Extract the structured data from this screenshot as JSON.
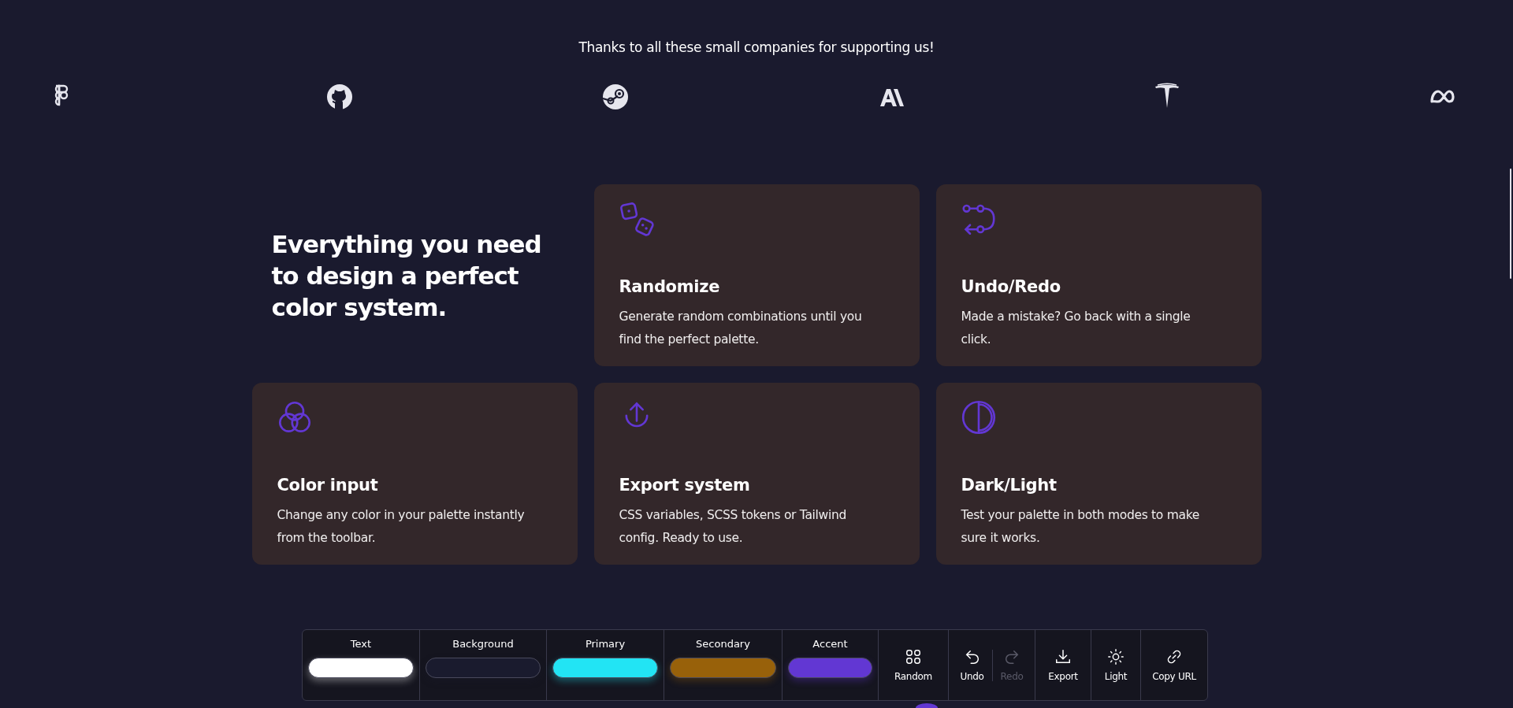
{
  "sponsors": {
    "caption": "Thanks to all these small companies for supporting us!",
    "logos": [
      {
        "kind": "figma"
      },
      {
        "kind": "github"
      },
      {
        "kind": "steam"
      },
      {
        "kind": "anthropic"
      },
      {
        "kind": "tesla"
      },
      {
        "kind": "meta"
      }
    ]
  },
  "features": {
    "heading": "Everything you need to design a perfect color system.",
    "cards": [
      {
        "kind": "dice",
        "title": "Randomize",
        "text": "Generate random combinations until you find the perfect palette."
      },
      {
        "kind": "undo-redo",
        "title": "Undo/Redo",
        "text": "Made a mistake? Go back with a single click."
      },
      {
        "kind": "circles",
        "title": "Color input",
        "text": "Change any color in your palette instantly from the toolbar."
      },
      {
        "kind": "upload",
        "title": "Export system",
        "text": "CSS variables, SCSS tokens or Tailwind config. Ready to use."
      },
      {
        "kind": "half-circle",
        "title": "Dark/Light",
        "text": "Test your palette in both modes to make sure it works."
      }
    ]
  },
  "toolbar": {
    "swatches": [
      {
        "label": "Text",
        "color": "#ffffff"
      },
      {
        "label": "Background",
        "color": "#1a1b2e"
      },
      {
        "label": "Primary",
        "color": "#22e4f4"
      },
      {
        "label": "Secondary",
        "color": "#98610a"
      },
      {
        "label": "Accent",
        "color": "#6237d3"
      }
    ],
    "actions": [
      {
        "kind": "random",
        "label": "Random",
        "disabled": false
      },
      {
        "kind": "undo",
        "label": "Undo",
        "disabled": false
      },
      {
        "kind": "redo",
        "label": "Redo",
        "disabled": true
      },
      {
        "kind": "export",
        "label": "Export",
        "disabled": false
      },
      {
        "kind": "light",
        "label": "Light",
        "disabled": false
      },
      {
        "kind": "link",
        "label": "Copy URL",
        "disabled": false
      }
    ]
  }
}
